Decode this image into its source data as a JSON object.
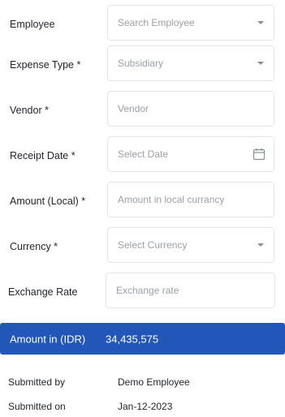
{
  "form": {
    "employee": {
      "label": "Employee",
      "placeholder": "Search Employee"
    },
    "expense_type": {
      "label": "Expense Type *",
      "placeholder": "Subsidiary"
    },
    "vendor": {
      "label": "Vendor *",
      "placeholder": "Vendor"
    },
    "receipt_date": {
      "label": "Receipt Date *",
      "placeholder": "Select Date"
    },
    "amount_local": {
      "label": "Amount (Local) *",
      "placeholder": "Amount in local currancy"
    },
    "currency": {
      "label": "Currency *",
      "placeholder": "Select Currency"
    },
    "exchange_rate": {
      "label": "Exchange Rate",
      "placeholder": "Exchange rate"
    }
  },
  "summary": {
    "amount_label": "Amount in (IDR)",
    "amount_value": "34,435,575"
  },
  "meta": {
    "submitted_by_label": "Submitted by",
    "submitted_by_value": "Demo Employee",
    "submitted_on_label": "Submitted on",
    "submitted_on_value": "Jan-12-2023"
  },
  "icons": {
    "dropdown": "chevron-down-icon",
    "calendar": "calendar-icon"
  },
  "colors": {
    "accent": "#2256b8",
    "border": "#e3e5e8",
    "placeholder": "#9aa0a6"
  }
}
